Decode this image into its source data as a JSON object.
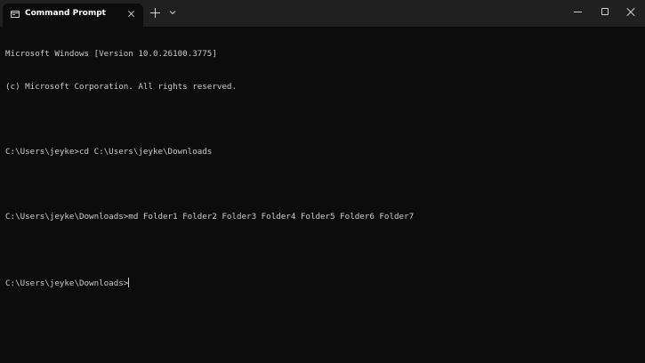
{
  "window": {
    "tab_title": "Command Prompt",
    "icons": {
      "tab": "terminal-icon",
      "tab_close": "close-icon",
      "new_tab": "plus-icon",
      "dropdown": "chevron-down-icon",
      "minimize": "minimize-icon",
      "maximize": "maximize-icon",
      "close": "close-icon"
    }
  },
  "console": {
    "lines": [
      "Microsoft Windows [Version 10.0.26100.3775]",
      "(c) Microsoft Corporation. All rights reserved.",
      "",
      "C:\\Users\\jeyke>cd C:\\Users\\jeyke\\Downloads",
      "",
      "C:\\Users\\jeyke\\Downloads>md Folder1 Folder2 Folder3 Folder4 Folder5 Folder6 Folder7",
      "",
      "C:\\Users\\jeyke\\Downloads>"
    ]
  },
  "colors": {
    "console_background": "#0c0c0c",
    "titlebar_background": "#202020",
    "console_text": "#cccccc"
  }
}
